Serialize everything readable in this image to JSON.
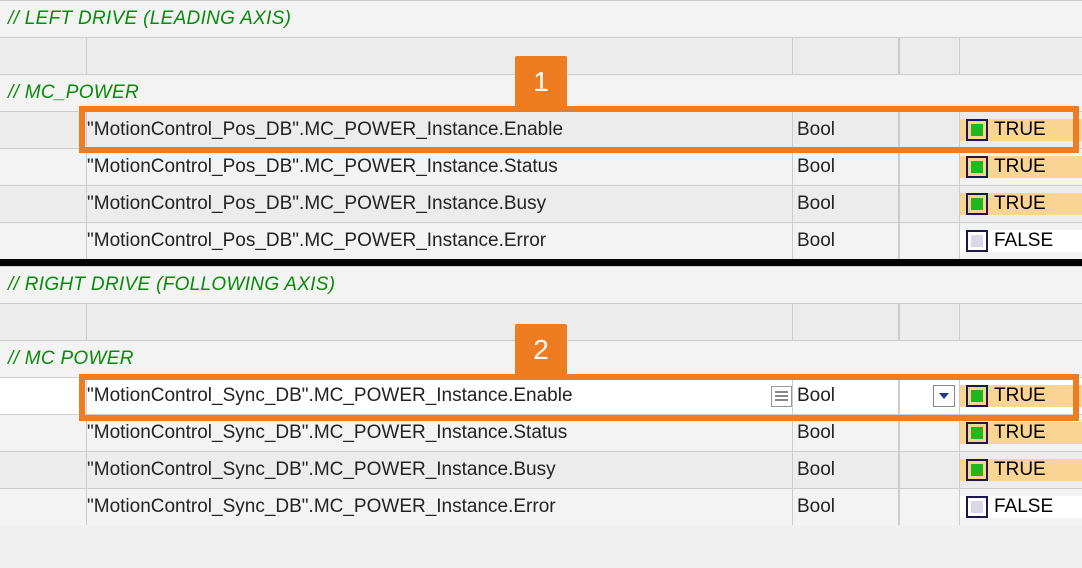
{
  "groups": [
    {
      "group_comment": "// LEFT DRIVE (LEADING AXIS)",
      "block_comment": "// MC_POWER",
      "callout": "1",
      "rows": [
        {
          "name": "\"MotionControl_Pos_DB\".MC_POWER_Instance.Enable",
          "type": "Bool",
          "value": "TRUE",
          "highlight": true,
          "select": false
        },
        {
          "name": "\"MotionControl_Pos_DB\".MC_POWER_Instance.Status",
          "type": "Bool",
          "value": "TRUE"
        },
        {
          "name": "\"MotionControl_Pos_DB\".MC_POWER_Instance.Busy",
          "type": "Bool",
          "value": "TRUE"
        },
        {
          "name": "\"MotionControl_Pos_DB\".MC_POWER_Instance.Error",
          "type": "Bool",
          "value": "FALSE"
        }
      ]
    },
    {
      "group_comment": "// RIGHT DRIVE (FOLLOWING AXIS)",
      "block_comment": "// MC POWER",
      "callout": "2",
      "rows": [
        {
          "name": "\"MotionControl_Sync_DB\".MC_POWER_Instance.Enable",
          "type": "Bool",
          "value": "TRUE",
          "highlight": true,
          "select": true
        },
        {
          "name": "\"MotionControl_Sync_DB\".MC_POWER_Instance.Status",
          "type": "Bool",
          "value": "TRUE"
        },
        {
          "name": "\"MotionControl_Sync_DB\".MC_POWER_Instance.Busy",
          "type": "Bool",
          "value": "TRUE"
        },
        {
          "name": "\"MotionControl_Sync_DB\".MC_POWER_Instance.Error",
          "type": "Bool",
          "value": "FALSE"
        }
      ]
    }
  ]
}
